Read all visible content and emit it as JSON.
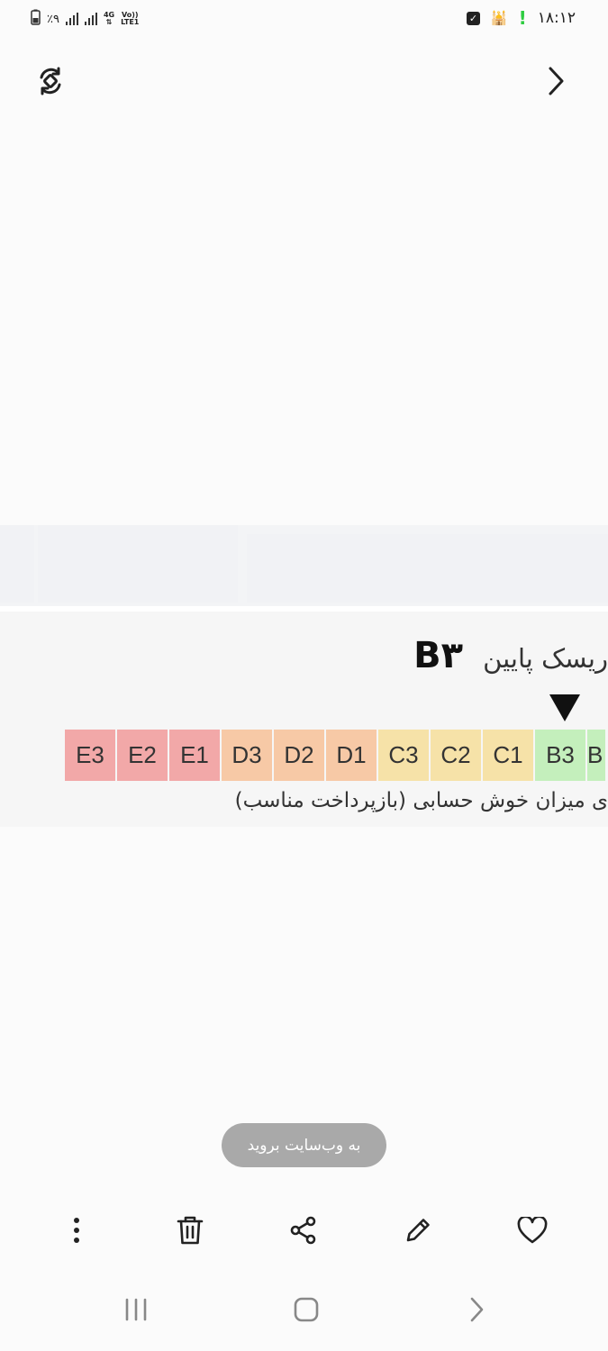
{
  "status_bar": {
    "time": "۱۸:۱۲",
    "battery": "٪۹",
    "network": "4G",
    "volte_line1": "Vo))",
    "volte_line2": "LTE1",
    "icons": [
      "battery-icon",
      "signal-icon",
      "signal-icon",
      "data-arrows-icon",
      "volte-icon",
      "checkbox-notification-icon",
      "mosque-icon",
      "alert-icon"
    ]
  },
  "toolbar": {
    "icons": [
      "rotate-icon",
      "chevron-right-icon"
    ]
  },
  "image_content": {
    "risk_label": "ریسک پایین",
    "risk_grade": "B۳",
    "grades": [
      {
        "label": "E3",
        "color": "#f2a8a8"
      },
      {
        "label": "E2",
        "color": "#f2a8a8"
      },
      {
        "label": "E1",
        "color": "#f2a8a8"
      },
      {
        "label": "D3",
        "color": "#f7c9a6"
      },
      {
        "label": "D2",
        "color": "#f7c9a6"
      },
      {
        "label": "D1",
        "color": "#f7c9a6"
      },
      {
        "label": "C3",
        "color": "#f6e2a8"
      },
      {
        "label": "C2",
        "color": "#f6e2a8"
      },
      {
        "label": "C1",
        "color": "#f6e2a8"
      },
      {
        "label": "B3",
        "color": "#c4efbc"
      },
      {
        "label": "B",
        "color": "#c4efbc"
      }
    ],
    "selected_grade": "B3",
    "caption": "ی میزان خوش حسابی (بازپرداخت مناسب)"
  },
  "toast": {
    "label": "به وب‌سایت بروید"
  },
  "action_bar": {
    "icons": [
      "more-options-icon",
      "delete-icon",
      "share-icon",
      "edit-icon",
      "favorite-icon"
    ]
  },
  "nav_bar": {
    "icons": [
      "recents-icon",
      "home-icon",
      "back-icon"
    ]
  }
}
